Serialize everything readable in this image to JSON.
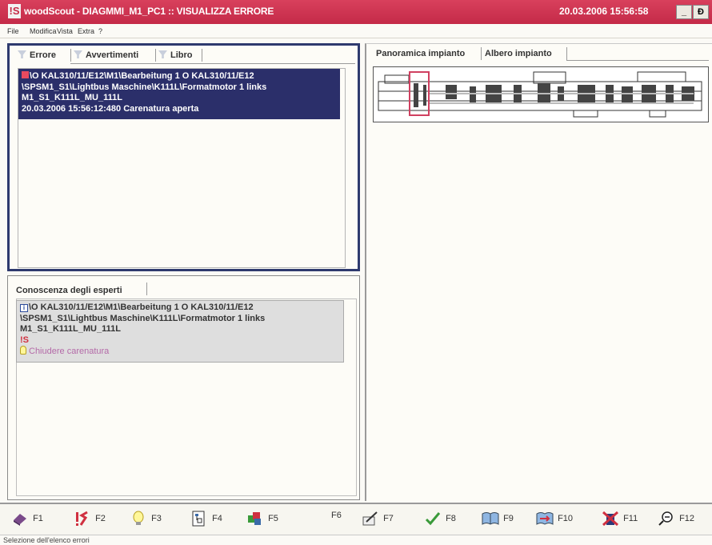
{
  "window": {
    "app_icon_text": "!S",
    "title": "woodScout - DIAGMMI_M1_PC1 :: VISUALIZZA ERRORE",
    "datetime": "20.03.2006 15:56:58",
    "minimize": "_",
    "restore": "Ɖ"
  },
  "menu": [
    "File",
    "Modifica",
    "Vista",
    "Extra",
    "?"
  ],
  "errors_panel": {
    "tabs": [
      "Errore",
      "Avvertimenti",
      "Libro"
    ],
    "selected_error": {
      "line1": "\\O KAL310/11/E12\\M1\\Bearbeitung 1 O KAL310/11/E12",
      "line2": "\\SPSM1_S1\\Lightbus Maschine\\K111L\\Formatmotor 1 links",
      "line3": "M1_S1_K111L_MU_111L",
      "line4": "20.03.2006 15:56:12:480  Carenatura aperta"
    }
  },
  "experts_panel": {
    "tab": "Conoscenza degli esperti",
    "info_icon": "i",
    "line1": "\\O KAL310/11/E12\\M1\\Bearbeitung 1 O KAL310/11/E12",
    "line2": "\\SPSM1_S1\\Lightbus Maschine\\K111L\\Formatmotor 1 links",
    "line3": "M1_S1_K111L_MU_111L",
    "flash": "!S",
    "solution": "Chiudere carenatura"
  },
  "plant_panel": {
    "tabs": [
      "Panoramica impianto",
      "Albero impianto"
    ]
  },
  "function_keys": [
    {
      "label": "F1",
      "icon": "eraser-icon"
    },
    {
      "label": "F2",
      "icon": "error-flash-icon"
    },
    {
      "label": "F3",
      "icon": "lightbulb-icon"
    },
    {
      "label": "F4",
      "icon": "tree-doc-icon"
    },
    {
      "label": "F5",
      "icon": "cubes-icon"
    },
    {
      "label": "F6",
      "icon": ""
    },
    {
      "label": "F7",
      "icon": "write-note-icon"
    },
    {
      "label": "F8",
      "icon": "checkmark-icon"
    },
    {
      "label": "F9",
      "icon": "open-book-icon"
    },
    {
      "label": "F10",
      "icon": "book-arrow-icon"
    },
    {
      "label": "F11",
      "icon": "cross-person-icon"
    },
    {
      "label": "F12",
      "icon": "zoom-out-icon"
    }
  ],
  "status": "Selezione dell'elenco errori",
  "colors": {
    "titlebar": "#c42a48",
    "selection": "#2b2f6a",
    "solution_text": "#b46aa8"
  }
}
